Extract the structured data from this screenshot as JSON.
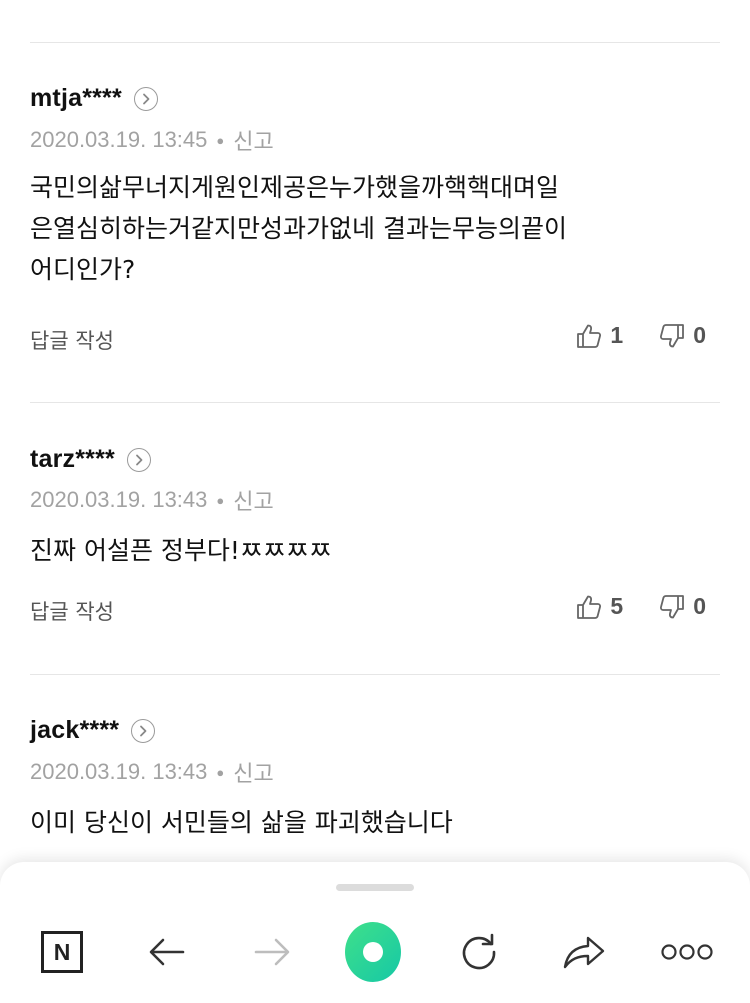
{
  "comments": [
    {
      "author": "mtja****",
      "timestamp": "2020.03.19. 13:45",
      "report_label": "신고",
      "content_lines": [
        "국민의삶무너지게원인제공은누가했을까핵핵대며일",
        "은열심히하는거같지만성과가없네 결과는무능의끝이",
        "어디인가?"
      ],
      "reply_label": "답글 작성",
      "likes": "1",
      "dislikes": "0"
    },
    {
      "author": "tarz****",
      "timestamp": "2020.03.19. 13:43",
      "report_label": "신고",
      "content_lines": [
        "진짜 어설픈 정부다!ㅉㅉㅉㅉ"
      ],
      "reply_label": "답글 작성",
      "likes": "5",
      "dislikes": "0"
    },
    {
      "author": "jack****",
      "timestamp": "2020.03.19. 13:43",
      "report_label": "신고",
      "content_lines": [
        "이미 당신이 서민들의 삶을 파괴했습니다"
      ]
    }
  ],
  "toolbar": {
    "n_label": "N",
    "icons": [
      "naver-home-icon",
      "back-arrow-icon",
      "forward-arrow-icon",
      "green-dot-icon",
      "refresh-icon",
      "share-icon",
      "more-icon"
    ]
  },
  "colors": {
    "accent_green_start": "#3fe08a",
    "accent_green_end": "#16c8a6",
    "meta_gray": "#a2a2a2"
  }
}
